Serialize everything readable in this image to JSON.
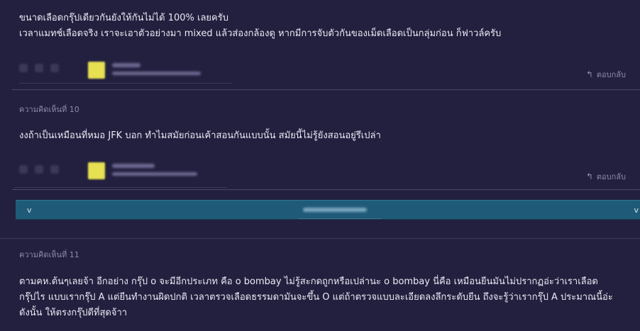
{
  "comment9": {
    "line1": "ขนาดเลือดกรุ๊ปเดียวกันยังให้กันไม่ได้ 100% เลยครับ",
    "line2": "เวลาแมทช์เลือดจริง เราจะเอาตัวอย่างมา mixed แล้วส่องกล้องดู หากมีการจับตัวกันของเม็ดเลือดเป็นกลุ่มก่อน ก็ฟาวล์ครับ",
    "reply_label": "ตอบกลับ"
  },
  "comment10": {
    "label": "ความคิดเห็นที่ 10",
    "text": "งงถ้าเป็นเหมือนที่หมอ JFK บอก ทำไมสมัยก่อนเค้าสอนกันแบบนั้น  สมัยนี้ไม่รู้ยังสอนอยู่รึเปล่า",
    "reply_label": "ตอบกลับ"
  },
  "band": {
    "left_chevron": "v",
    "right_chevron": "v"
  },
  "comment11": {
    "label": "ความคิดเห็นที่ 11",
    "line1": "ตามคห.ต้นๆเลยจ้า อีกอย่าง กรุ๊ป o จะมีอีกประเภท คือ o bombay ไม่รู้สะกดถูกหรือเปล่านะ o bombay นี่คือ เหมือนยีนมันไม่ปรากฏอ่ะว่าเราเลือด",
    "line2": "กรุ๊ปไร แบบเรากรุ๊ป A แต่ยีนทำงานผิดปกติ เวลาตรวจเลือดธรรมดามันจะขึ้น O แต่ถ้าตรวจแบบละเอียดลงลึกระดับยีน ถึงจะรู้ว่าเรากรุ๊ป A ประมาณนี้อ่ะ",
    "line3": "ดังนั้น ให้ตรงกรุ๊ปดีที่สุดจ้าา"
  },
  "colors": {
    "background": "#23203f",
    "band": "#1f5a78",
    "avatar": "#e6e052"
  }
}
